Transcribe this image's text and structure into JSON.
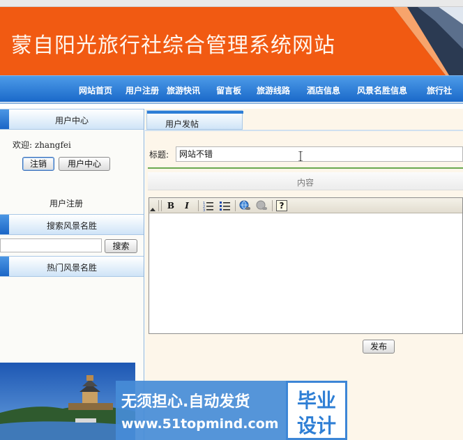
{
  "site": {
    "title": "蒙自阳光旅行社综合管理系统网站"
  },
  "nav": {
    "items": [
      "网站首页",
      "用户注册",
      "旅游快讯",
      "留言板",
      "旅游线路",
      "酒店信息",
      "风景名胜信息",
      "旅行社"
    ]
  },
  "sidebar": {
    "user_center": {
      "heading": "用户中心",
      "welcome_label": "欢迎:",
      "username": "zhangfei",
      "logout_button": "注销",
      "user_center_button": "用户中心",
      "register_link": "用户注册"
    },
    "search": {
      "heading": "搜索风景名胜",
      "input_value": "",
      "button": "搜索"
    },
    "hot": {
      "heading": "热门风景名胜"
    }
  },
  "main": {
    "tab_label": "用户发帖",
    "title_label": "标题:",
    "title_value": "网站不错",
    "content_label": "内容",
    "toolbar": {
      "bold": "B",
      "italic": "I",
      "help": "?"
    },
    "publish_button": "发布"
  },
  "watermark": {
    "slogan": "无须担心.自动发货",
    "url": "www.51topmind.com",
    "badge_line1": "毕业",
    "badge_line2": "设计"
  },
  "colors": {
    "banner": "#f15a12",
    "nav": "#1a69c9",
    "main_bg": "#fdf6ea",
    "divider_green": "#6aa84f"
  }
}
